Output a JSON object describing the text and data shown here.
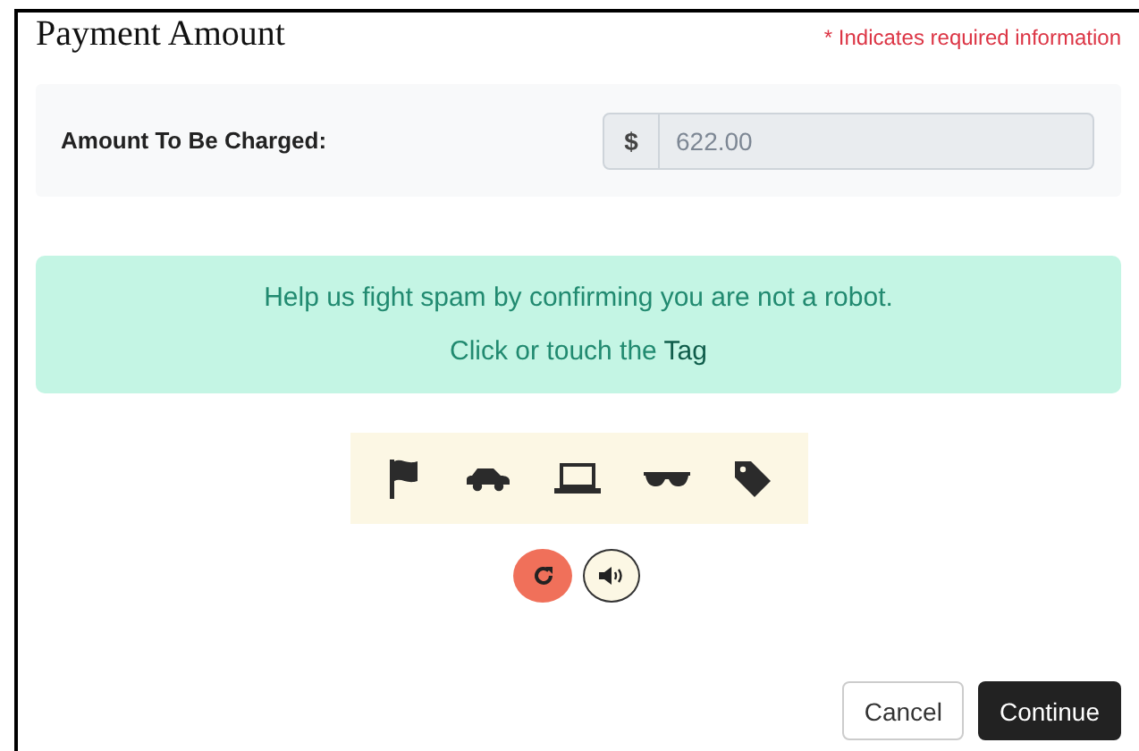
{
  "header": {
    "title": "Payment Amount",
    "required_note": "* Indicates required information"
  },
  "amount": {
    "label": "Amount To Be Charged:",
    "prefix": "$",
    "value": "622.00",
    "disabled": true
  },
  "captcha": {
    "message": "Help us fight spam by confirming you are not a robot.",
    "instruction": "Click or touch the **Tag**",
    "icons": [
      {
        "kind": "flag"
      },
      {
        "kind": "car"
      },
      {
        "kind": "laptop"
      },
      {
        "kind": "glasses"
      },
      {
        "kind": "tag"
      }
    ]
  },
  "buttons": [
    {
      "label": "Cancel",
      "kind": "secondary"
    },
    {
      "label": "Continue",
      "kind": "primary"
    }
  ]
}
